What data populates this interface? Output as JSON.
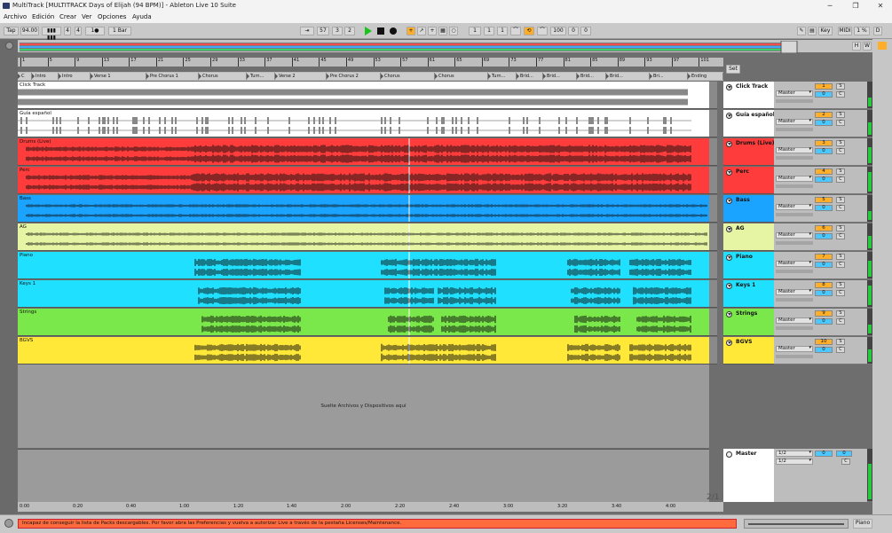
{
  "window": {
    "title": "MultiTrack  [MULTITRACK Days of Elijah (94 BPM)] - Ableton Live 10 Suite",
    "buttons": [
      "─",
      "❐",
      "✕"
    ]
  },
  "menu": [
    "Archivo",
    "Edición",
    "Crear",
    "Ver",
    "Opciones",
    "Ayuda"
  ],
  "transport": {
    "tap": "Tap",
    "tempo": "94.00",
    "sig_num": "4",
    "sig_den": "4",
    "metronome": "1●",
    "quantize": "1 Bar",
    "position": [
      "57",
      "3",
      "2"
    ],
    "loop_start": [
      "1",
      "1",
      "1"
    ],
    "loop_length": [
      "100",
      "0",
      "0"
    ],
    "key": "Key",
    "midi": "MIDI",
    "cpu": "1 %",
    "d": "D",
    "play_color": "#18c418",
    "accent": "#ffae2a"
  },
  "ruler": {
    "bars": [
      "1",
      "5",
      "9",
      "13",
      "17",
      "21",
      "25",
      "29",
      "33",
      "37",
      "41",
      "45",
      "49",
      "53",
      "57",
      "61",
      "65",
      "69",
      "73",
      "77",
      "81",
      "85",
      "89",
      "93",
      "97",
      "101"
    ]
  },
  "locators": [
    "C",
    "Intro",
    "Intro",
    "Verse 1",
    "Pre Chorus 1",
    "Chorus",
    "Turn...",
    "Verse 2",
    "Pre Chorus 2",
    "Chorus",
    "Chorus",
    "Turn...",
    "Brid...",
    "Brid...",
    "Brid...",
    "Brid...",
    "Bri...",
    "Ending"
  ],
  "tracks": [
    {
      "name": "Click Track",
      "lane_label": "Click Track",
      "color": "#ffffff",
      "number": "1",
      "route": "Master",
      "vol": "0",
      "solo": "S",
      "cue": "C",
      "wave": "click"
    },
    {
      "name": "Guía español",
      "lane_label": "Guía español",
      "color": "#ffffff",
      "number": "2",
      "route": "Master",
      "vol": "0",
      "solo": "S",
      "cue": "C",
      "wave": "sparse"
    },
    {
      "name": "Drums (Live)",
      "lane_label": "Drums (Live)",
      "color": "#ff3c3c",
      "number": "3",
      "route": "Master",
      "vol": "0",
      "solo": "S",
      "cue": "C",
      "wave": "dense"
    },
    {
      "name": "Perc",
      "lane_label": "Perc",
      "color": "#ff3c3c",
      "number": "4",
      "route": "Master",
      "vol": "0",
      "solo": "S",
      "cue": "C",
      "wave": "dense"
    },
    {
      "name": "Bass",
      "lane_label": "Bass",
      "color": "#1aa3ff",
      "number": "5",
      "route": "Master",
      "vol": "0",
      "solo": "S",
      "cue": "C",
      "wave": "flat"
    },
    {
      "name": "AG",
      "lane_label": "AG",
      "color": "#e6f5a3",
      "number": "6",
      "route": "Master",
      "vol": "0",
      "solo": "S",
      "cue": "C",
      "wave": "flat"
    },
    {
      "name": "Piano",
      "lane_label": "Piano",
      "color": "#1fe1ff",
      "number": "7",
      "route": "Master",
      "vol": "0",
      "solo": "S",
      "cue": "C",
      "wave": "blocks"
    },
    {
      "name": "Keys 1",
      "lane_label": "Keys 1",
      "color": "#1fe1ff",
      "number": "8",
      "route": "Master",
      "vol": "0",
      "solo": "S",
      "cue": "C",
      "wave": "blocks"
    },
    {
      "name": "Strings",
      "lane_label": "Strings",
      "color": "#7ae84a",
      "number": "9",
      "route": "Master",
      "vol": "0",
      "solo": "S",
      "cue": "C",
      "wave": "blocks"
    },
    {
      "name": "BGVS",
      "lane_label": "BGVS",
      "color": "#ffe838",
      "number": "10",
      "route": "Master",
      "vol": "0",
      "solo": "S",
      "cue": "C",
      "wave": "blocks"
    }
  ],
  "drop_text": "Suelte Archivos y Dispositivos aquí",
  "master": {
    "name": "Master",
    "route1": "1/2",
    "route2": "1/2",
    "vol": "0",
    "vol2": "0",
    "cue": "C",
    "color": "#ffffff"
  },
  "set_label": "Set",
  "timeline": [
    "0:00",
    "0:20",
    "0:40",
    "1:00",
    "1:20",
    "1:40",
    "2:00",
    "2:20",
    "2:40",
    "3:00",
    "3:20",
    "3:40",
    "4:00"
  ],
  "page_indicator": "2/1",
  "status": "Incapaz de conseguir la lista de Packs descargables. Por favor abra las Preferencias y vuelva a autorizar Live a través de la pestaña Licenses/Maintenance.",
  "status_color": "#ff6b3d",
  "bottom_right_label": "Piano",
  "overview_hw": [
    "H",
    "W"
  ]
}
